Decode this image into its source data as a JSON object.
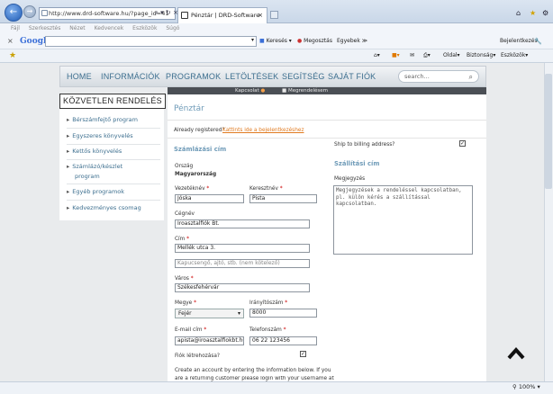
{
  "browser": {
    "address": "http://www.drd-software.hu/?page_id=41",
    "tab_title": "Pénztár | DRD-Software",
    "menu": [
      "Fájl",
      "Szerkesztés",
      "Nézet",
      "Kedvencek",
      "Eszközök",
      "Súgó"
    ],
    "google": {
      "logo": "Google",
      "search_label": "Keresés",
      "share_label": "Megosztás",
      "more_label": "Egyebek ≫",
      "signin_label": "Bejelentkezés"
    },
    "cmd": {
      "page": "Oldal",
      "safety": "Biztonság",
      "tools": "Eszközök"
    },
    "zoom": "100%"
  },
  "site": {
    "nav": [
      "HOME",
      "INFORMÁCIÓK",
      "PROGRAMOK",
      "LETÖLTÉSEK",
      "SEGÍTSÉG",
      "SAJÁT FIÓK"
    ],
    "search_placeholder": "search...",
    "subnav": [
      "Kapcsolat",
      "Megrendelésem"
    ]
  },
  "sidebar": {
    "title": "KÖZVETLEN RENDELÉS",
    "items": [
      "Bérszámfejtő program",
      "Egyszeres könyvelés",
      "Kettős könyvelés",
      "Számlázó/készlet",
      "program",
      "Egyéb programok",
      "Kedvezményes csomag"
    ]
  },
  "checkout": {
    "title": "Pénztár",
    "already_registered": "Already registered?",
    "login_link": "Kattints ide a bejelentkezéshez",
    "billing_header": "Számlázási cím",
    "ship_to_billing": "Ship to billing address?",
    "shipping_header": "Szállítási cím",
    "country_label": "Ország",
    "country_value": "Magyarország",
    "last_name_label": "Vezetéknév",
    "last_name_value": "Jóska",
    "first_name_label": "Keresztnév",
    "first_name_value": "Pista",
    "company_label": "Cégnév",
    "company_value": "Iroasztalfiók Bt.",
    "address_label": "Cím",
    "address_value": "Mellék utca 3.",
    "address2_placeholder": "Kapucsengő, ajtó, stb. (nem kötelező)",
    "city_label": "Város",
    "city_value": "Székesfehérvár",
    "county_label": "Megye",
    "county_value": "Fejér",
    "zip_label": "Irányítószám",
    "zip_value": "8000",
    "email_label": "E-mail cím",
    "email_value": "apista@iroasztalfiokbt.hu",
    "phone_label": "Telefonszám",
    "phone_value": "06 22 123456",
    "create_account_label": "Fiók létrehozása?",
    "notes_label": "Megjegyzés",
    "notes_placeholder": "Megjegyzések a rendeléssel kapcsolatban, pl. külön kérés a szállítással kapcsolatban.",
    "create_account_text1": "Create an account by entering the information below. If you",
    "create_account_text2": "are a returning customer please login with your username at"
  }
}
